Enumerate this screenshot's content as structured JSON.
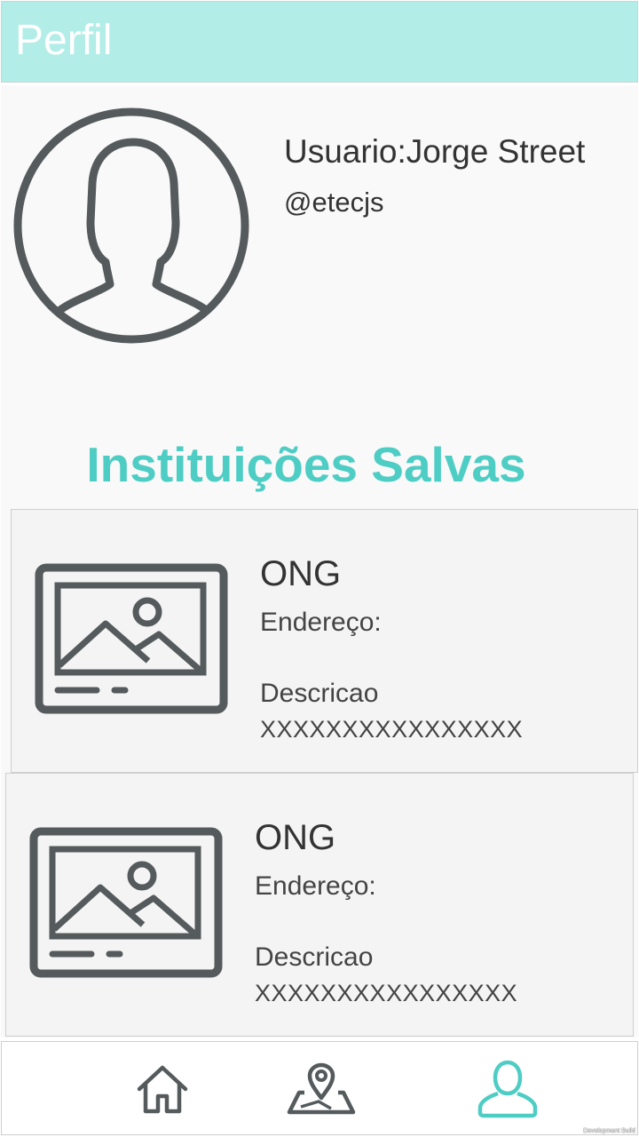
{
  "header": {
    "title": "Perfil"
  },
  "profile": {
    "avatar_icon": "user-avatar-icon",
    "user_label": "Usuario:Jorge Street",
    "handle": "@etecjs"
  },
  "saved_section": {
    "title": "Instituições Salvas",
    "cards": [
      {
        "image_icon": "image-placeholder-icon",
        "name": "ONG",
        "address_label": "Endereço:",
        "description_label": "Descricao",
        "description_value": "XXXXXXXXXXXXXXXX"
      },
      {
        "image_icon": "image-placeholder-icon",
        "name": "ONG",
        "address_label": "Endereço:",
        "description_label": "Descricao",
        "description_value": "XXXXXXXXXXXXXXXX"
      }
    ]
  },
  "bottom_nav": {
    "items": [
      {
        "icon": "home-icon",
        "active": false
      },
      {
        "icon": "map-pin-icon",
        "active": false
      },
      {
        "icon": "user-icon",
        "active": true
      }
    ]
  },
  "colors": {
    "header_bg": "#b3ede8",
    "accent": "#4ecdc4",
    "icon_gray": "#555555",
    "text": "#333333"
  },
  "watermark": "Development Build"
}
